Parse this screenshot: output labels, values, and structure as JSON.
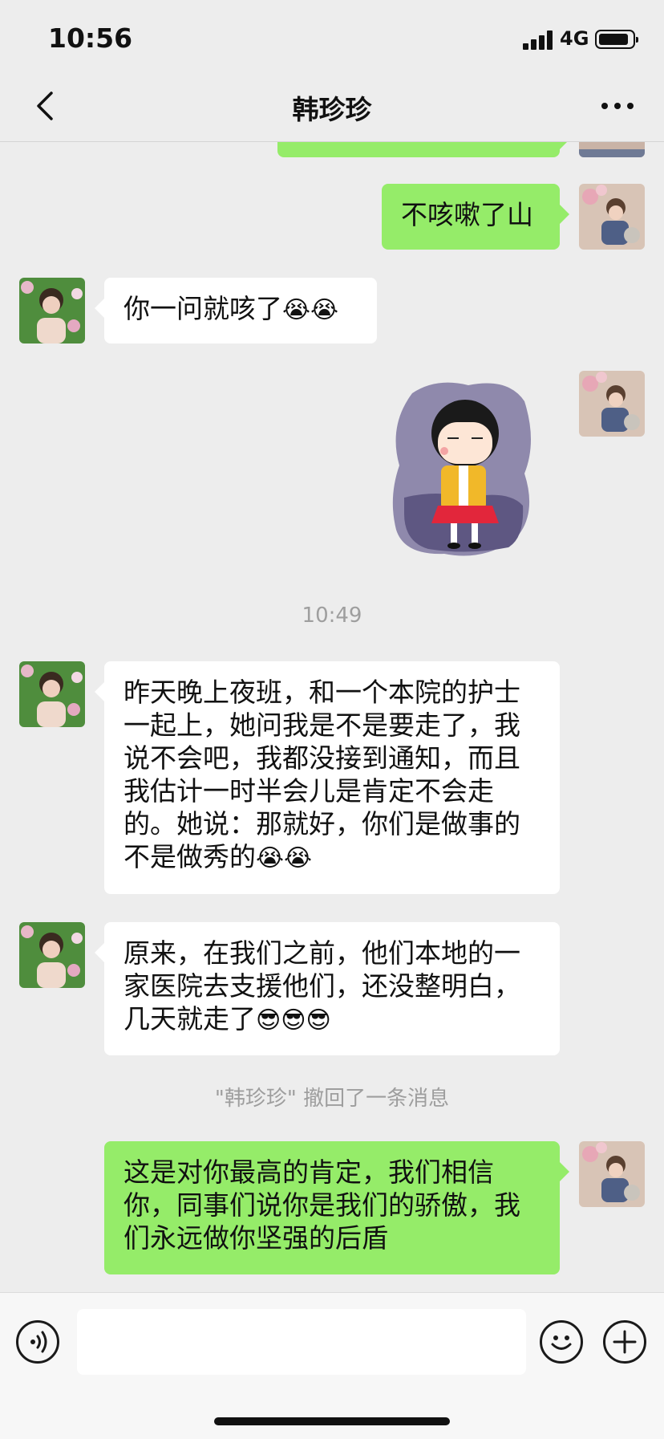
{
  "status_bar": {
    "time": "10:56",
    "network": "4G"
  },
  "header": {
    "title": "韩珍珍"
  },
  "messages": {
    "m2": {
      "text": "不咳嗽了山"
    },
    "m3": {
      "text": "你一问就咳了",
      "emoji": "😭😭"
    },
    "time1": "10:49",
    "m5": {
      "lines": [
        "昨天晚上夜班，和一个本院的护士",
        "一起上，她问我是不是要走了，我",
        "说不会吧，我都没接到通知，而且",
        "我估计一时半会儿是肯定不会走",
        "的。她说：那就好，你们是做事的",
        "不是做秀的"
      ],
      "emoji": "😭😭"
    },
    "m6": {
      "lines": [
        "原来，在我们之前，他们本地的一",
        "家医院去支援他们，还没整明白，",
        "几天就走了"
      ],
      "emoji": "😎😎😎"
    },
    "recall": "\"韩珍珍\" 撤回了一条消息",
    "m7": {
      "lines": [
        "这是对你最高的肯定，我们相信",
        "你，同事们说你是我们的骄傲，我",
        "们永远做你坚强的后盾"
      ]
    }
  },
  "colors": {
    "outgoing_bubble": "#95ec69",
    "incoming_bubble": "#ffffff",
    "background": "#ededed"
  }
}
